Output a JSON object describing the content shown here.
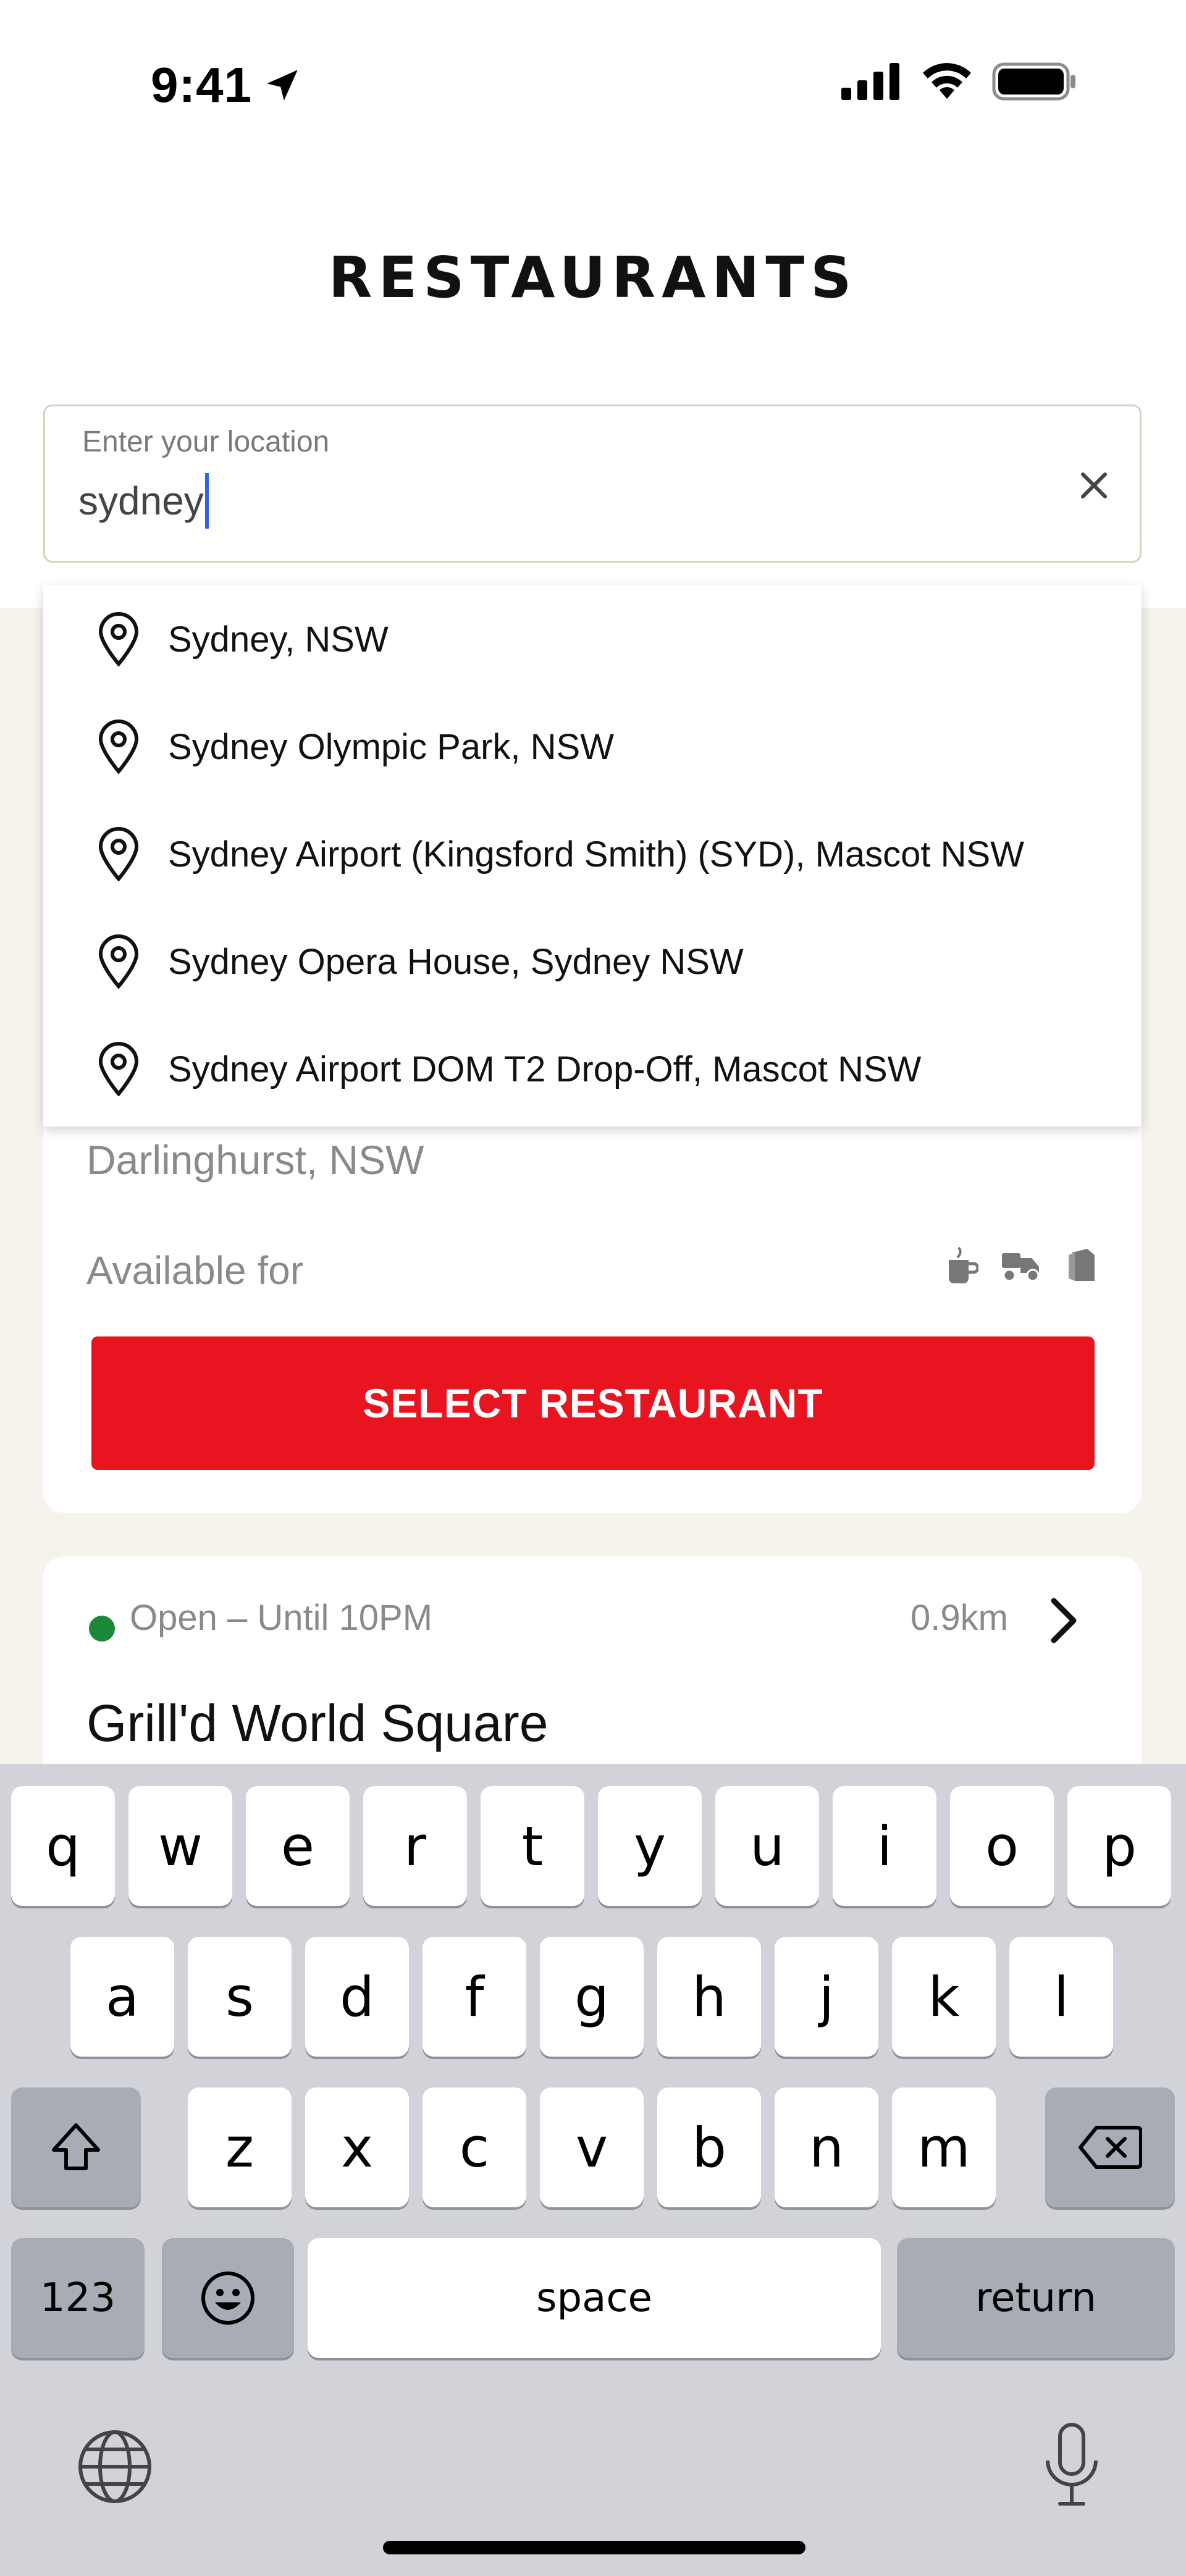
{
  "status_bar": {
    "time": "9:41"
  },
  "header": {
    "title": "RESTAURANTS"
  },
  "search": {
    "label": "Enter your location",
    "value": "sydney"
  },
  "suggestions": [
    "Sydney, NSW",
    "Sydney Olympic Park, NSW",
    "Sydney Airport (Kingsford Smith) (SYD), Mascot NSW",
    "Sydney Opera House, Sydney NSW",
    "Sydney Airport DOM T2 Drop-Off, Mascot NSW"
  ],
  "restaurant_card_1": {
    "address": "Darlinghurst, NSW",
    "available_label": "Available for",
    "select_label": "SELECT RESTAURANT"
  },
  "restaurant_card_2": {
    "status": "Open – Until 10PM",
    "distance": "0.9km",
    "name": "Grill'd World Square"
  },
  "keyboard": {
    "row1": [
      "q",
      "w",
      "e",
      "r",
      "t",
      "y",
      "u",
      "i",
      "o",
      "p"
    ],
    "row2": [
      "a",
      "s",
      "d",
      "f",
      "g",
      "h",
      "j",
      "k",
      "l"
    ],
    "row3": [
      "z",
      "x",
      "c",
      "v",
      "b",
      "n",
      "m"
    ],
    "numbers_label": "123",
    "space_label": "space",
    "return_label": "return"
  },
  "colors": {
    "brand_red": "#e8141f",
    "caret_blue": "#3461e6",
    "open_green": "#1a8a3a",
    "beige_bg": "#f6f3ed"
  }
}
